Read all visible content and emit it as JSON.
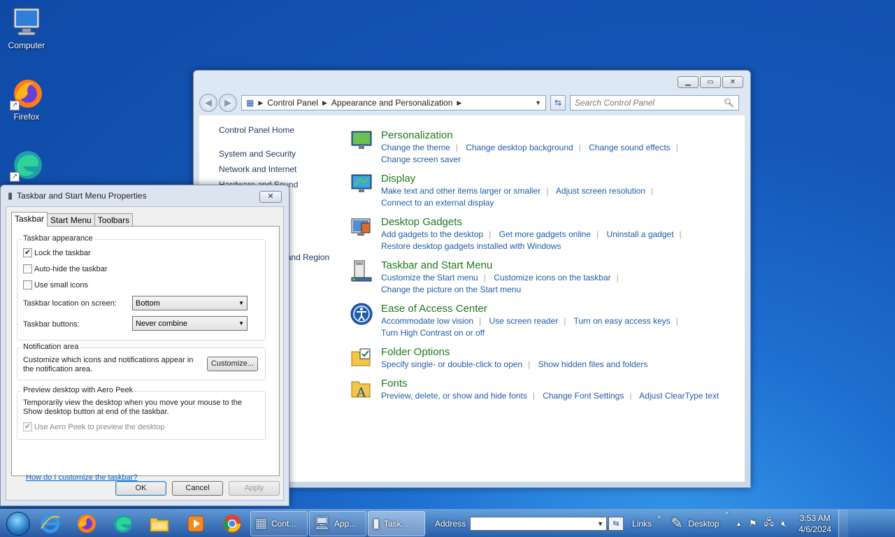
{
  "desktop": {
    "icons": [
      {
        "label": "Computer"
      },
      {
        "label": "Firefox"
      },
      {
        "label": ""
      }
    ]
  },
  "control_panel": {
    "breadcrumb": [
      "Control Panel",
      "Appearance and Personalization"
    ],
    "search_placeholder": "Search Control Panel",
    "left_nav": [
      "Control Panel Home",
      "System and Security",
      "Network and Internet",
      "Hardware and Sound",
      "Clock, Language, and Region"
    ],
    "categories": [
      {
        "title": "Personalization",
        "icon": "personalization-icon",
        "links": [
          "Change the theme",
          "Change desktop background",
          "Change sound effects",
          "Change screen saver"
        ]
      },
      {
        "title": "Display",
        "icon": "display-icon",
        "links": [
          "Make text and other items larger or smaller",
          "Adjust screen resolution",
          "Connect to an external display"
        ]
      },
      {
        "title": "Desktop Gadgets",
        "icon": "gadgets-icon",
        "links": [
          "Add gadgets to the desktop",
          "Get more gadgets online",
          "Uninstall a gadget",
          "Restore desktop gadgets installed with Windows"
        ]
      },
      {
        "title": "Taskbar and Start Menu",
        "icon": "taskbar-icon",
        "links": [
          "Customize the Start menu",
          "Customize icons on the taskbar",
          "Change the picture on the Start menu"
        ]
      },
      {
        "title": "Ease of Access Center",
        "icon": "ease-of-access-icon",
        "links": [
          "Accommodate low vision",
          "Use screen reader",
          "Turn on easy access keys",
          "Turn High Contrast on or off"
        ]
      },
      {
        "title": "Folder Options",
        "icon": "folder-options-icon",
        "links": [
          "Specify single- or double-click to open",
          "Show hidden files and folders"
        ]
      },
      {
        "title": "Fonts",
        "icon": "fonts-icon",
        "links": [
          "Preview, delete, or show and hide fonts",
          "Change Font Settings",
          "Adjust ClearType text"
        ]
      }
    ]
  },
  "dialog": {
    "title": "Taskbar and Start Menu Properties",
    "tabs": [
      "Taskbar",
      "Start Menu",
      "Toolbars"
    ],
    "appearance": {
      "group_title": "Taskbar appearance",
      "lock_label": "Lock the taskbar",
      "lock_checked": true,
      "autohide_label": "Auto-hide the taskbar",
      "small_icons_label": "Use small icons",
      "location_label": "Taskbar location on screen:",
      "location_value": "Bottom",
      "buttons_label": "Taskbar buttons:",
      "buttons_value": "Never combine"
    },
    "notification": {
      "group_title": "Notification area",
      "text": "Customize which icons and notifications appear in the notification area.",
      "customize_label": "Customize..."
    },
    "peek": {
      "group_title": "Preview desktop with Aero Peek",
      "text": "Temporarily view the desktop when you move your mouse to the Show desktop button at end of the taskbar.",
      "checkbox_label": "Use Aero Peek to preview the desktop"
    },
    "help_link": "How do I customize the taskbar?",
    "ok_label": "OK",
    "cancel_label": "Cancel",
    "apply_label": "Apply"
  },
  "taskbar": {
    "buttons": [
      {
        "label": "Cont..."
      },
      {
        "label": "App..."
      },
      {
        "label": "Task..."
      }
    ],
    "address_label": "Address",
    "links_label": "Links",
    "desktop_label": "Desktop",
    "time": "3:53 AM",
    "date": "4/6/2024"
  }
}
